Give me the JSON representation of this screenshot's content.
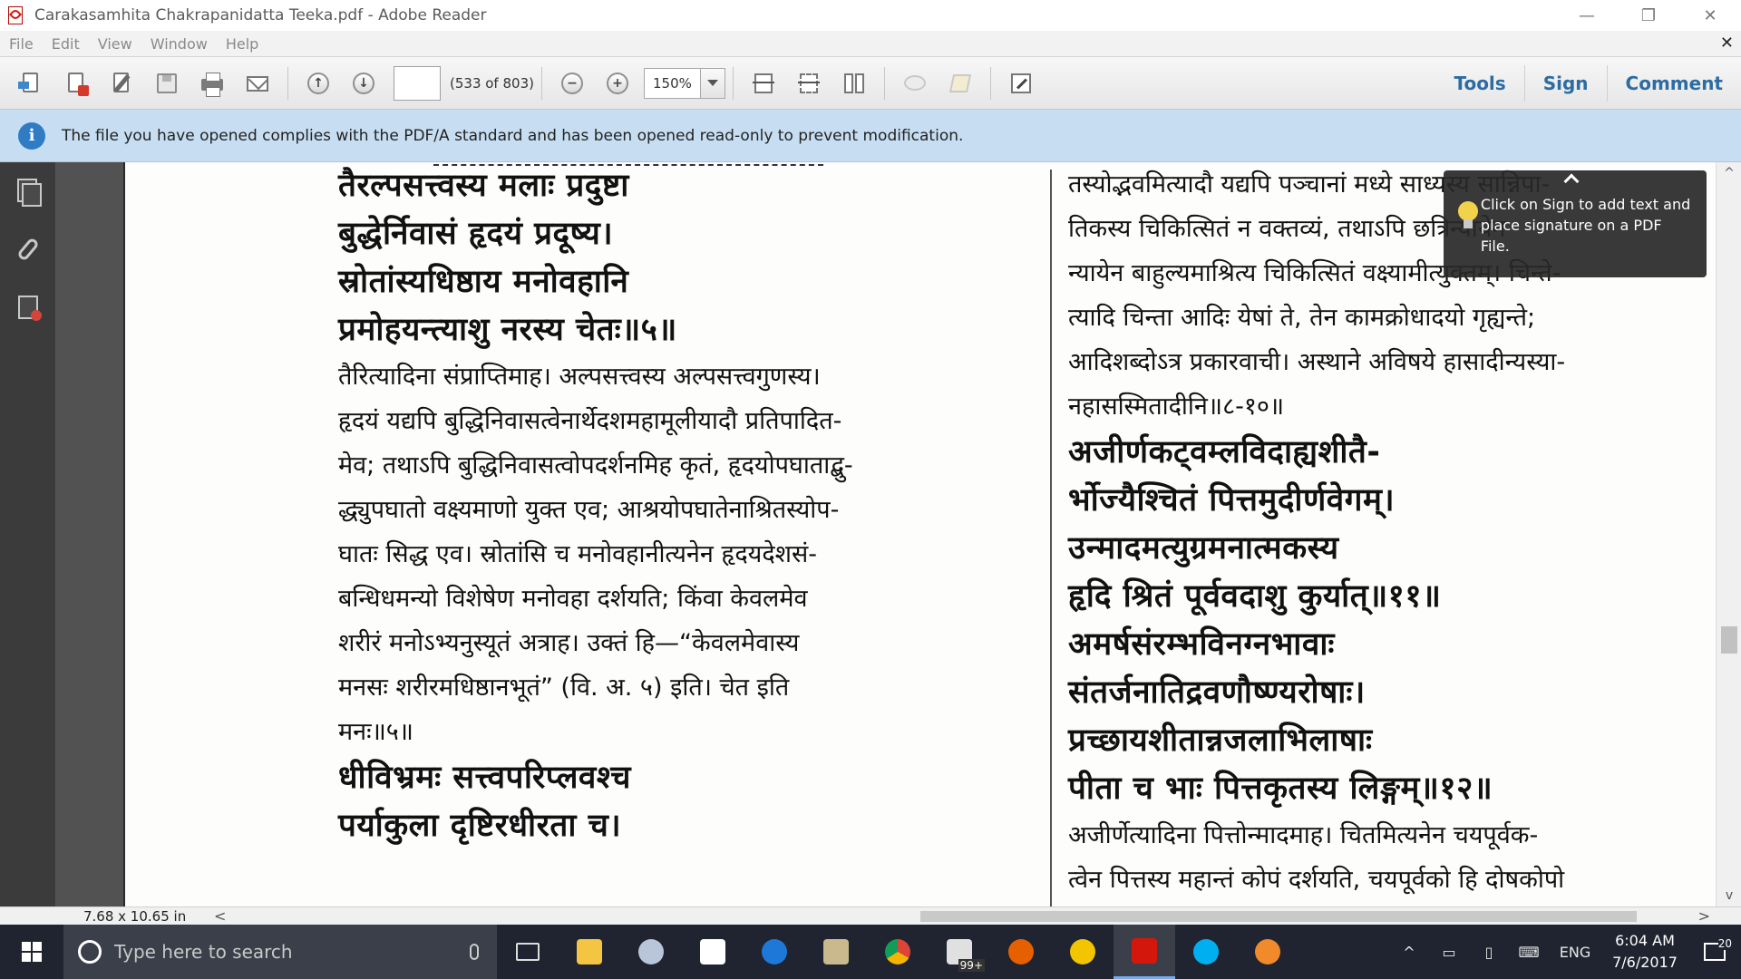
{
  "window": {
    "title": "Carakasamhita Chakrapanidatta Teeka.pdf - Adobe Reader",
    "minimize": "—",
    "restore": "❐",
    "close": "✕"
  },
  "menu": {
    "items": [
      "File",
      "Edit",
      "View",
      "Window",
      "Help"
    ],
    "close": "✕"
  },
  "toolbar": {
    "page_value": "",
    "page_count": "(533 of 803)",
    "zoom_out": "−",
    "zoom_in": "+",
    "zoom_value": "150%",
    "page_up": "↑",
    "page_down": "↓",
    "tabs": [
      "Tools",
      "Sign",
      "Comment"
    ]
  },
  "infobar": {
    "icon": "i",
    "message": "The file you have opened complies with the PDF/A standard and has been opened read-only to prevent modification."
  },
  "tooltip": {
    "text": "Click on Sign to add text and place signature on a PDF File."
  },
  "document": {
    "left_column": [
      {
        "kind": "verse",
        "text": "तैरल्पसत्त्वस्य मलाः प्रदुष्टा"
      },
      {
        "kind": "verse",
        "text": "बुद्धेर्निवासं हृदयं प्रदूष्य।"
      },
      {
        "kind": "verse",
        "text": "स्रोतांस्यधिष्ठाय मनोवहानि"
      },
      {
        "kind": "verse",
        "text": "प्रमोहयन्त्याशु नरस्य चेतः॥५॥"
      },
      {
        "kind": "prose",
        "text": "   तैरित्यादिना संप्राप्तिमाह। अल्पसत्त्वस्य अल्पसत्त्वगुणस्य।"
      },
      {
        "kind": "prose",
        "text": "हृदयं यद्यपि बुद्धिनिवासत्वेनार्थेदशमहामूलीयादौ प्रतिपादित-"
      },
      {
        "kind": "prose",
        "text": "मेव; तथाऽपि बुद्धिनिवासत्वोपदर्शनमिह कृतं, हृदयोपघाताद्बु-"
      },
      {
        "kind": "prose",
        "text": "द्ध्युपघातो वक्ष्यमाणो युक्त एव; आश्रयोपघातेनाश्रितस्योप-"
      },
      {
        "kind": "prose",
        "text": "घातः सिद्ध एव। स्रोतांसि च मनोवहानीत्यनेन हृदयदेशसं-"
      },
      {
        "kind": "prose",
        "text": "बन्धिधमन्यो विशेषेण मनोवहा दर्शयति; किंवा केवलमेव"
      },
      {
        "kind": "prose",
        "text": "शरीरं मनोऽभ्यनुस्यूतं अत्राह। उक्तं हि—“केवलमेवास्य"
      },
      {
        "kind": "prose",
        "text": "मनसः शरीरमधिष्ठानभूतं” (वि. अ. ५) इति। चेत इति"
      },
      {
        "kind": "prose",
        "text": "मनः॥५॥"
      },
      {
        "kind": "verse",
        "text": "धीविभ्रमः सत्त्वपरिप्लवश्च"
      },
      {
        "kind": "verse",
        "text": "पर्याकुला दृष्टिरधीरता च।"
      }
    ],
    "right_column": [
      {
        "kind": "prose",
        "text": "   तस्योद्भवमित्यादौ यद्यपि पञ्चानां मध्ये साध्यस्य सान्निपा-"
      },
      {
        "kind": "prose",
        "text": "तिकस्य चिकित्सितं न वक्तव्यं, तथाऽपि छत्रिन्यायेन"
      },
      {
        "kind": "prose",
        "text": "न्यायेन बाहुल्यमाश्रित्य चिकित्सितं वक्ष्यामीत्युक्तम्। चिन्ते-"
      },
      {
        "kind": "prose",
        "text": "त्यादि चिन्ता आदिः येषां ते, तेन कामक्रोधादयो गृह्यन्ते;"
      },
      {
        "kind": "prose",
        "text": "आदिशब्दोऽत्र प्रकारवाची। अस्थाने अविषये हासादीन्यस्या-"
      },
      {
        "kind": "prose",
        "text": "नहासस्मितादीनि॥८-१०॥"
      },
      {
        "kind": "verse",
        "text": "   अजीर्णकट्वम्लविदाह्यशीतै-"
      },
      {
        "kind": "verse",
        "text": "   र्भोज्यैश्चितं पित्तमुदीर्णवेगम्।"
      },
      {
        "kind": "verse",
        "text": "   उन्मादमत्युग्रमनात्मकस्य"
      },
      {
        "kind": "verse",
        "text": "   हृदि श्रितं पूर्ववदाशु कुर्यात्॥११॥"
      },
      {
        "kind": "verse",
        "text": "   अमर्षसंरम्भविनग्नभावाः"
      },
      {
        "kind": "verse",
        "text": "   संतर्जनातिद्रवणौष्ण्यरोषाः।"
      },
      {
        "kind": "verse",
        "text": "   प्रच्छायशीतान्नजलाभिलाषाः"
      },
      {
        "kind": "verse",
        "text": "   पीता च भाः पित्तकृतस्य लिङ्गम्॥१२॥"
      },
      {
        "kind": "prose",
        "text": "   अजीर्णेत्यादिना पित्तोन्मादमाह। चितमित्यनेन चयपूर्वक-"
      },
      {
        "kind": "prose",
        "text": "त्वेन पित्तस्य महान्तं कोपं दर्शयति, चयपूर्वको हि दोषकोपो"
      }
    ]
  },
  "statusbar": {
    "page_size": "7.68 x 10.65 in",
    "scroll_left": "<",
    "scroll_right": ">"
  },
  "scrollbar": {
    "up": "^",
    "down": "v"
  },
  "taskbar": {
    "search_placeholder": "Type here to search",
    "language": "ENG",
    "time": "6:04 AM",
    "date": "7/6/2017",
    "notification_count": "20",
    "store_badge": "99+",
    "chevron": "^"
  },
  "colors": {
    "accent": "#2d6ca3",
    "infobar": "#c7def2",
    "taskbar": "#1f2430"
  }
}
